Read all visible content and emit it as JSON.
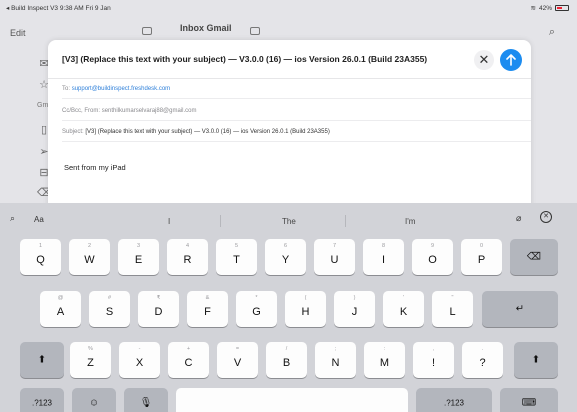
{
  "status_bar": {
    "left": "◂ Build Inspect V3  9:38 AM  Fri 9 Jan",
    "battery": "42%"
  },
  "background": {
    "edit_label": "Edit",
    "inbox_title": "Inbox Gmail",
    "gmail_label": "Gmi",
    "search_icon": "magnifier-icon"
  },
  "compose": {
    "title": "[V3] (Replace this text with your subject) — V3.0.0 (16) — ios Version 26.0.1 (Build 23A355)",
    "close_icon": "close-icon",
    "send_icon": "send-arrow-icon",
    "to_label": "To:",
    "to_value": "support@buildinspect.freshdesk.com",
    "ccbcc_label": "Cc/Bcc, From:",
    "from_value": "senthilkumarselvaraj88@gmail.com",
    "subject_label": "Subject:",
    "subject_value": "[V3] (Replace this text with your subject) — V3.0.0 (16) — ios Version 26.0.1 (Build 23A355)",
    "body": "Sent from my iPad"
  },
  "keyboard": {
    "format_label": "Aa",
    "suggestions": [
      "I",
      "The",
      "I'm"
    ],
    "row1": [
      {
        "k": "Q",
        "a": "1"
      },
      {
        "k": "W",
        "a": "2"
      },
      {
        "k": "E",
        "a": "3"
      },
      {
        "k": "R",
        "a": "4"
      },
      {
        "k": "T",
        "a": "5"
      },
      {
        "k": "Y",
        "a": "6"
      },
      {
        "k": "U",
        "a": "7"
      },
      {
        "k": "I",
        "a": "8"
      },
      {
        "k": "O",
        "a": "9"
      },
      {
        "k": "P",
        "a": "0"
      }
    ],
    "row2": [
      {
        "k": "A",
        "a": "@"
      },
      {
        "k": "S",
        "a": "#"
      },
      {
        "k": "D",
        "a": "₹"
      },
      {
        "k": "F",
        "a": "&"
      },
      {
        "k": "G",
        "a": "*"
      },
      {
        "k": "H",
        "a": "("
      },
      {
        "k": "J",
        "a": ")"
      },
      {
        "k": "K",
        "a": "'"
      },
      {
        "k": "L",
        "a": "\""
      }
    ],
    "row3": [
      {
        "k": "Z",
        "a": "%"
      },
      {
        "k": "X",
        "a": "-"
      },
      {
        "k": "C",
        "a": "+"
      },
      {
        "k": "V",
        "a": "="
      },
      {
        "k": "B",
        "a": "/"
      },
      {
        "k": "N",
        "a": ";"
      },
      {
        "k": "M",
        "a": ":"
      },
      {
        "k": "!",
        "a": ","
      },
      {
        "k": "?",
        "a": "."
      }
    ],
    "num_left": ".?123",
    "num_right": ".?123",
    "emoji_icon": "emoji-icon",
    "mic_icon": "microphone-icon",
    "delete_icon": "backspace-icon",
    "return_icon": "return-icon",
    "shift_icon": "shift-icon",
    "hide_keyboard_icon": "keyboard-dismiss-icon"
  }
}
